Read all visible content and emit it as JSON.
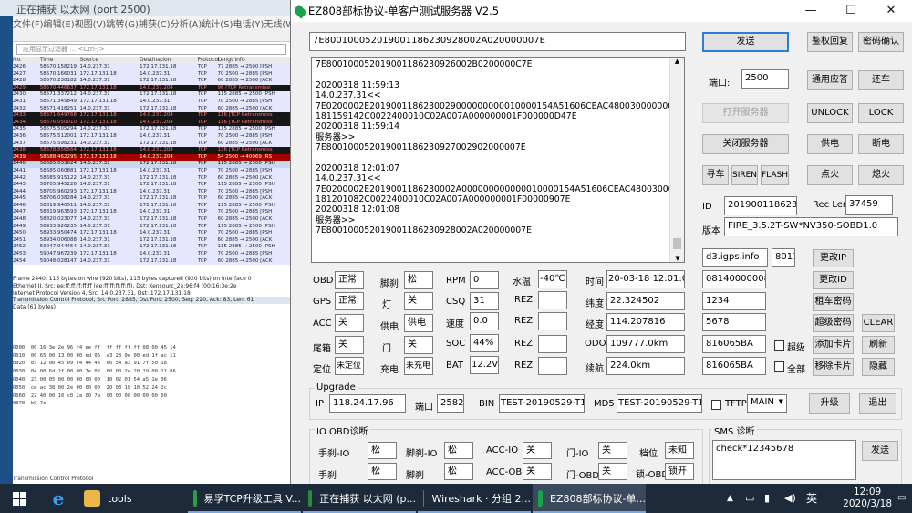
{
  "wireshark": {
    "title": "正在捕获 以太网 (port 2500)",
    "menu": "文件(F)编辑(E)视图(V)跳转(G)捕获(C)分析(A)统计(S)电话(Y)无线(W)工具(T)帮",
    "filter_placeholder": "应用显示过滤器 … <Ctrl-/>",
    "columns": [
      "No.",
      "Time",
      "Source",
      "Destination",
      "Protocol",
      "Lengt Info"
    ],
    "rows": [
      [
        "2426",
        "58570.158219",
        "14.0.237.31",
        "172.17.131.18",
        "TCP",
        "77 2885 → 2500 [PSH"
      ],
      [
        "2427",
        "58570.166031",
        "172.17.131.18",
        "14.0.237.31",
        "TCP",
        "70 2500 → 2885 [PSH"
      ],
      [
        "2428",
        "58570.238182",
        "14.0.237.31",
        "172.17.131.18",
        "TCP",
        "60 2885 → 2500 [ACK"
      ],
      [
        "2429",
        "58570.446637",
        "172.17.131.18",
        "14.0.237.204",
        "TCP",
        "96 [TCP Retransmissi"
      ],
      [
        "2430",
        "58571.337212",
        "14.0.237.31",
        "172.17.131.18",
        "TCP",
        "115 2885 → 2500 [PSH"
      ],
      [
        "2431",
        "58571.345849",
        "172.17.131.18",
        "14.0.237.31",
        "TCP",
        "70 2500 → 2885 [PSH"
      ],
      [
        "2432",
        "58571.418251",
        "14.0.237.31",
        "172.17.131.18",
        "TCP",
        "60 2885 → 2500 [ACK"
      ],
      [
        "2433",
        "58571.649768",
        "172.17.131.18",
        "14.0.237.204",
        "TCP",
        "116 [TCP Retransmiss"
      ],
      [
        "2434",
        "58576.050010",
        "172.17.131.18",
        "14.0.237.204",
        "TCP",
        "116 [TCP Retransmiss"
      ],
      [
        "2435",
        "58575.505294",
        "14.0.237.31",
        "172.17.131.18",
        "TCP",
        "115 2885 → 2500 [PSH"
      ],
      [
        "2436",
        "58575.512001",
        "172.17.131.18",
        "14.0.237.31",
        "TCP",
        "70 2500 → 2885 [PSH"
      ],
      [
        "2437",
        "58575.598231",
        "14.0.237.31",
        "172.17.131.18",
        "TCP",
        "60 2885 → 2500 [ACK"
      ],
      [
        "2438",
        "58578.856564",
        "172.17.131.18",
        "14.0.237.204",
        "TCP",
        "136 [TCP Retransmiss"
      ],
      [
        "2439",
        "58588.462295",
        "172.17.131.18",
        "14.0.237.204",
        "TCP",
        "54 2500 → 40069 [RS"
      ],
      [
        "2440",
        "58685.033624",
        "14.0.237.31",
        "172.17.131.18",
        "TCP",
        "115 2885 → 2500 [PSH"
      ],
      [
        "2441",
        "58685.060881",
        "172.17.131.18",
        "14.0.237.31",
        "TCP",
        "70 2500 → 2885 [PSH"
      ],
      [
        "2442",
        "58685.915122",
        "14.0.237.31",
        "172.17.131.18",
        "TCP",
        "60 2885 → 2500 [ACK"
      ],
      [
        "2443",
        "58705.945226",
        "14.0.237.31",
        "172.17.131.18",
        "TCP",
        "115 2885 → 2500 [PSH"
      ],
      [
        "2444",
        "58705.960293",
        "172.17.131.18",
        "14.0.237.31",
        "TCP",
        "70 2500 → 2885 [PSH"
      ],
      [
        "2445",
        "58706.038284",
        "14.0.237.31",
        "172.17.131.18",
        "TCP",
        "60 2885 → 2500 [ACK"
      ],
      [
        "2446",
        "58819.940511",
        "14.0.237.31",
        "172.17.131.18",
        "TCP",
        "115 2885 → 2500 [PSH"
      ],
      [
        "2447",
        "58819.963593",
        "172.17.131.18",
        "14.0.237.31",
        "TCP",
        "70 2500 → 2885 [PSH"
      ],
      [
        "2448",
        "58820.023077",
        "14.0.237.31",
        "172.17.131.18",
        "TCP",
        "60 2885 → 2500 [ACK"
      ],
      [
        "2449",
        "58933.926235",
        "14.0.237.31",
        "172.17.131.18",
        "TCP",
        "115 2885 → 2500 [PSH"
      ],
      [
        "2450",
        "58933.950474",
        "172.17.131.18",
        "14.0.237.31",
        "TCP",
        "70 2500 → 2885 [PSH"
      ],
      [
        "2451",
        "58934.006088",
        "14.0.237.31",
        "172.17.131.18",
        "TCP",
        "60 2885 → 2500 [ACK"
      ],
      [
        "2452",
        "59047.944454",
        "14.0.237.31",
        "172.17.131.18",
        "TCP",
        "115 2885 → 2500 [PSH"
      ],
      [
        "2453",
        "59047.967239",
        "172.17.131.18",
        "14.0.237.31",
        "TCP",
        "70 2500 → 2885 [PSH"
      ],
      [
        "2454",
        "59048.028147",
        "14.0.237.31",
        "172.17.131.18",
        "TCP",
        "60 2885 → 2500 [ACK"
      ]
    ],
    "details": [
      "Frame 2440: 115 bytes on wire (920 bits), 115 bytes captured (920 bits) on interface 0",
      "Ethernet II, Src: ee:ff:ff:ff:ff:ff (ee:ff:ff:ff:ff:ff), Dst: Xensourc_2e:96:f4 (00:16:3e:2e",
      "Internet Protocol Version 4, Src: 14.0.237.31, Dst: 172.17.131.18",
      "Transmission Control Protocol, Src Port: 2885, Dst Port: 2500, Seq: 220, Ack: 83, Len: 61",
      "Data (61 bytes)"
    ],
    "hex": [
      "0000  00 16 3e 2e 96 f4 ee ff  ff ff ff ff 08 00 45 14",
      "0010  00 65 00 13 00 00 ed 06  a3 28 0e 00 ed 1f ac 11",
      "0020  83 12 0b 45 09 c4 44 4e  d6 54 a3 91 7f 50 18",
      "0030  04 00 6d 2f 00 00 7e 02  00 00 2e 20 19 00 11 86",
      "0040  23 00 05 00 00 00 00 00  10 02 01 54 a5 1e 06",
      "0050  ce ac 38 00 2e 00 00 00  20 03 18 10 52 24 2c",
      "0060  22 40 00 10 c0 2a 00 7a  00 00 00 00 00 00 00",
      "0070  b9 7e"
    ],
    "status": "Transmission Control Protocol"
  },
  "app": {
    "title": "EZ808部标协议-单客户测试服务器 V2.5",
    "send_input": "7E800100052019001186230928002A020000007E",
    "log_lines": [
      "7E800100052019001186230926002B0200000C7E",
      "",
      "20200318 11:59:13",
      "14.0.237.31<<",
      "7E0200002E2019001186230029000000000010000154A51606CEAC4800300000000002003",
      "181159142C0022400010C02A007A000000001F000000D47E",
      "20200318 11:59:14",
      "服务器>>",
      "7E800100052019001186230927002902000007E",
      "",
      "20200318 12:01:07",
      "14.0.237.31<<",
      "7E0200002E2019001186230002A000000000000010000154A51606CEAC4800300000000002003",
      "181201082C0022400010C02A007A000000001F00000907E",
      "20200318 12:01:08",
      "服务器>>",
      "7E800100052019001186230928002A020000007E"
    ],
    "buttons": {
      "send": "发送",
      "auth_reply": "鉴权回复",
      "key_confirm": "密码确认",
      "general_reply": "通用应答",
      "return_car": "还车",
      "open_server": "打开服务器",
      "unlock": "UNLOCK",
      "lock": "LOCK",
      "close_server": "关闭服务器",
      "power_on": "供电",
      "power_off": "断电",
      "find_car": "寻车",
      "siren": "SIREN",
      "flash": "FLASH",
      "ignite": "点火",
      "flameout": "熄火",
      "change_ip": "更改IP",
      "change_id": "更改ID",
      "rent_key": "租车密码",
      "super_key": "超级密码",
      "clear": "CLEAR",
      "add_card": "添加卡片",
      "refresh": "刷新",
      "remove_card": "移除卡片",
      "hide": "隐藏",
      "upgrade": "升级",
      "exit": "退出",
      "sms_send": "发送"
    },
    "port_label": "端口:",
    "port_value": "2500",
    "id_label": "ID",
    "id_value": "201900118623",
    "reclen_label": "Rec Len",
    "reclen_value": "37459",
    "version_label": "版本",
    "version_value": "FIRE_3.5.2T-SW*NV350-SOBD1.0",
    "domain_value": "d3.igps.info",
    "domain_port": "8011",
    "right_fields": [
      "081400000086",
      "1234",
      "5678",
      "816065BA",
      "816065BA"
    ],
    "check_super": "超级",
    "check_all": "全部",
    "status_grid": {
      "obd_label": "OBD",
      "obd": "正常",
      "gps_label": "GPS",
      "gps": "正常",
      "acc_label": "ACC",
      "acc": "关",
      "trunk_label": "尾箱",
      "trunk": "关",
      "locate_label": "定位",
      "locate": "未定位",
      "brake_label": "脚刹",
      "brake": "松",
      "light_label": "灯",
      "light": "关",
      "supply_label": "供电",
      "supply": "供电",
      "door_label": "门",
      "door": "关",
      "charge_label": "充电",
      "charge": "未充电",
      "rpm_label": "RPM",
      "rpm": "0",
      "csq_label": "CSQ",
      "csq": "31",
      "speed_label": "速度",
      "speed": "0.0",
      "soc_label": "SOC",
      "soc": "44%",
      "bat_label": "BAT",
      "bat": "12.2V",
      "water_label": "水温",
      "water": "-40℃",
      "rez_label": "REZ",
      "time_label": "时间",
      "time": "20-03-18 12:01:08",
      "lat_label": "纬度",
      "lat": "22.324502",
      "lon_label": "经度",
      "lon": "114.207816",
      "odo_label": "ODO",
      "odo": "109777.0km",
      "range_label": "续航",
      "range": "224.0km"
    },
    "upgrade": {
      "group": "Upgrade",
      "ip_label": "IP",
      "ip": "118.24.17.96",
      "port_label": "端口",
      "port": "2582",
      "bin_label": "BIN",
      "bin": "TEST-20190529-T1.0",
      "md5_label": "MD5",
      "md5": "TEST-20190529-T1.0",
      "tftp_label": "TFTP",
      "main_select": "MAIN"
    },
    "io_obd": {
      "group": "IO OBD诊断",
      "handbrake_io_label": "手刹-IO",
      "handbrake_io": "松",
      "footbrake_io_label": "脚刹-IO",
      "footbrake_io": "松",
      "acc_io_label": "ACC-IO",
      "acc_io": "关",
      "door_io_label": "门-IO",
      "door_io": "关",
      "gear_label": "档位",
      "gear": "未知",
      "handbrake_label": "手刹",
      "handbrake": "松",
      "footbrake_label": "脚刹",
      "footbrake": "松",
      "acc_obd_label": "ACC-OBD",
      "acc_obd": "关",
      "door_obd_label": "门-OBD",
      "door_obd": "关",
      "lock_obd_label": "锁-OBD",
      "lock_obd": "锁开"
    },
    "sms": {
      "group": "SMS 诊断",
      "text": "check*12345678"
    }
  },
  "taskbar": {
    "items": [
      "tools",
      "易孚TCP升级工具 V...",
      "正在捕获 以太网 (p...",
      "Wireshark · 分组 2...",
      "EZ808部标协议-单..."
    ],
    "lang": "英",
    "time": "12:09",
    "date": "2020/3/18"
  }
}
